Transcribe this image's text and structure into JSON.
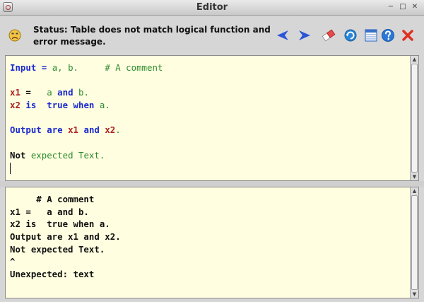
{
  "window": {
    "title": "Editor",
    "controls": {
      "minimize": "−",
      "maximize": "□",
      "close": "✕"
    }
  },
  "status": {
    "text": "Status: Table does not match logical function and error message.",
    "icon": "unhappy-face-icon"
  },
  "toolbar": [
    {
      "name": "back-arrow-icon",
      "color": "#2b55d6"
    },
    {
      "name": "forward-arrow-icon",
      "color": "#2b55d6"
    },
    {
      "name": "eraser-icon",
      "color": "#e84a4a"
    },
    {
      "name": "refresh-icon",
      "color": "#2a86d8"
    },
    {
      "name": "table-icon",
      "color": "#3a6fc9"
    },
    {
      "name": "help-icon",
      "color": "#2a78d8"
    },
    {
      "name": "close-icon",
      "color": "#e03020"
    }
  ],
  "editor": {
    "lines": [
      [
        {
          "t": "Input",
          "c": "kw"
        },
        {
          "t": " = ",
          "c": "kw"
        },
        {
          "t": "a, b.",
          "c": "lit"
        },
        {
          "t": "     ",
          "c": "plain"
        },
        {
          "t": "# A comment",
          "c": "lit"
        }
      ],
      [],
      [
        {
          "t": "x1",
          "c": "var"
        },
        {
          "t": " =   ",
          "c": "plain"
        },
        {
          "t": "a",
          "c": "lit"
        },
        {
          "t": " ",
          "c": "plain"
        },
        {
          "t": "and",
          "c": "kw"
        },
        {
          "t": " b.",
          "c": "lit"
        }
      ],
      [
        {
          "t": "x2",
          "c": "var"
        },
        {
          "t": " ",
          "c": "plain"
        },
        {
          "t": "is",
          "c": "kw"
        },
        {
          "t": "  ",
          "c": "plain"
        },
        {
          "t": "true",
          "c": "kw"
        },
        {
          "t": " ",
          "c": "plain"
        },
        {
          "t": "when",
          "c": "kw"
        },
        {
          "t": " a.",
          "c": "lit"
        }
      ],
      [],
      [
        {
          "t": "Output",
          "c": "kw"
        },
        {
          "t": " ",
          "c": "plain"
        },
        {
          "t": "are",
          "c": "kw"
        },
        {
          "t": " ",
          "c": "plain"
        },
        {
          "t": "x1",
          "c": "var"
        },
        {
          "t": " ",
          "c": "plain"
        },
        {
          "t": "and",
          "c": "kw"
        },
        {
          "t": " ",
          "c": "plain"
        },
        {
          "t": "x2",
          "c": "var"
        },
        {
          "t": ".",
          "c": "lit"
        }
      ],
      [],
      [
        {
          "t": "Not",
          "c": "plain"
        },
        {
          "t": " expected Text.",
          "c": "lit"
        }
      ]
    ],
    "caret_line": 8
  },
  "error_output": {
    "lines": [
      "     # A comment",
      "x1 =   a and b.",
      "x2 is  true when a.",
      "Output are x1 and x2.",
      "Not expected Text.",
      "^",
      "Unexpected: text"
    ]
  }
}
